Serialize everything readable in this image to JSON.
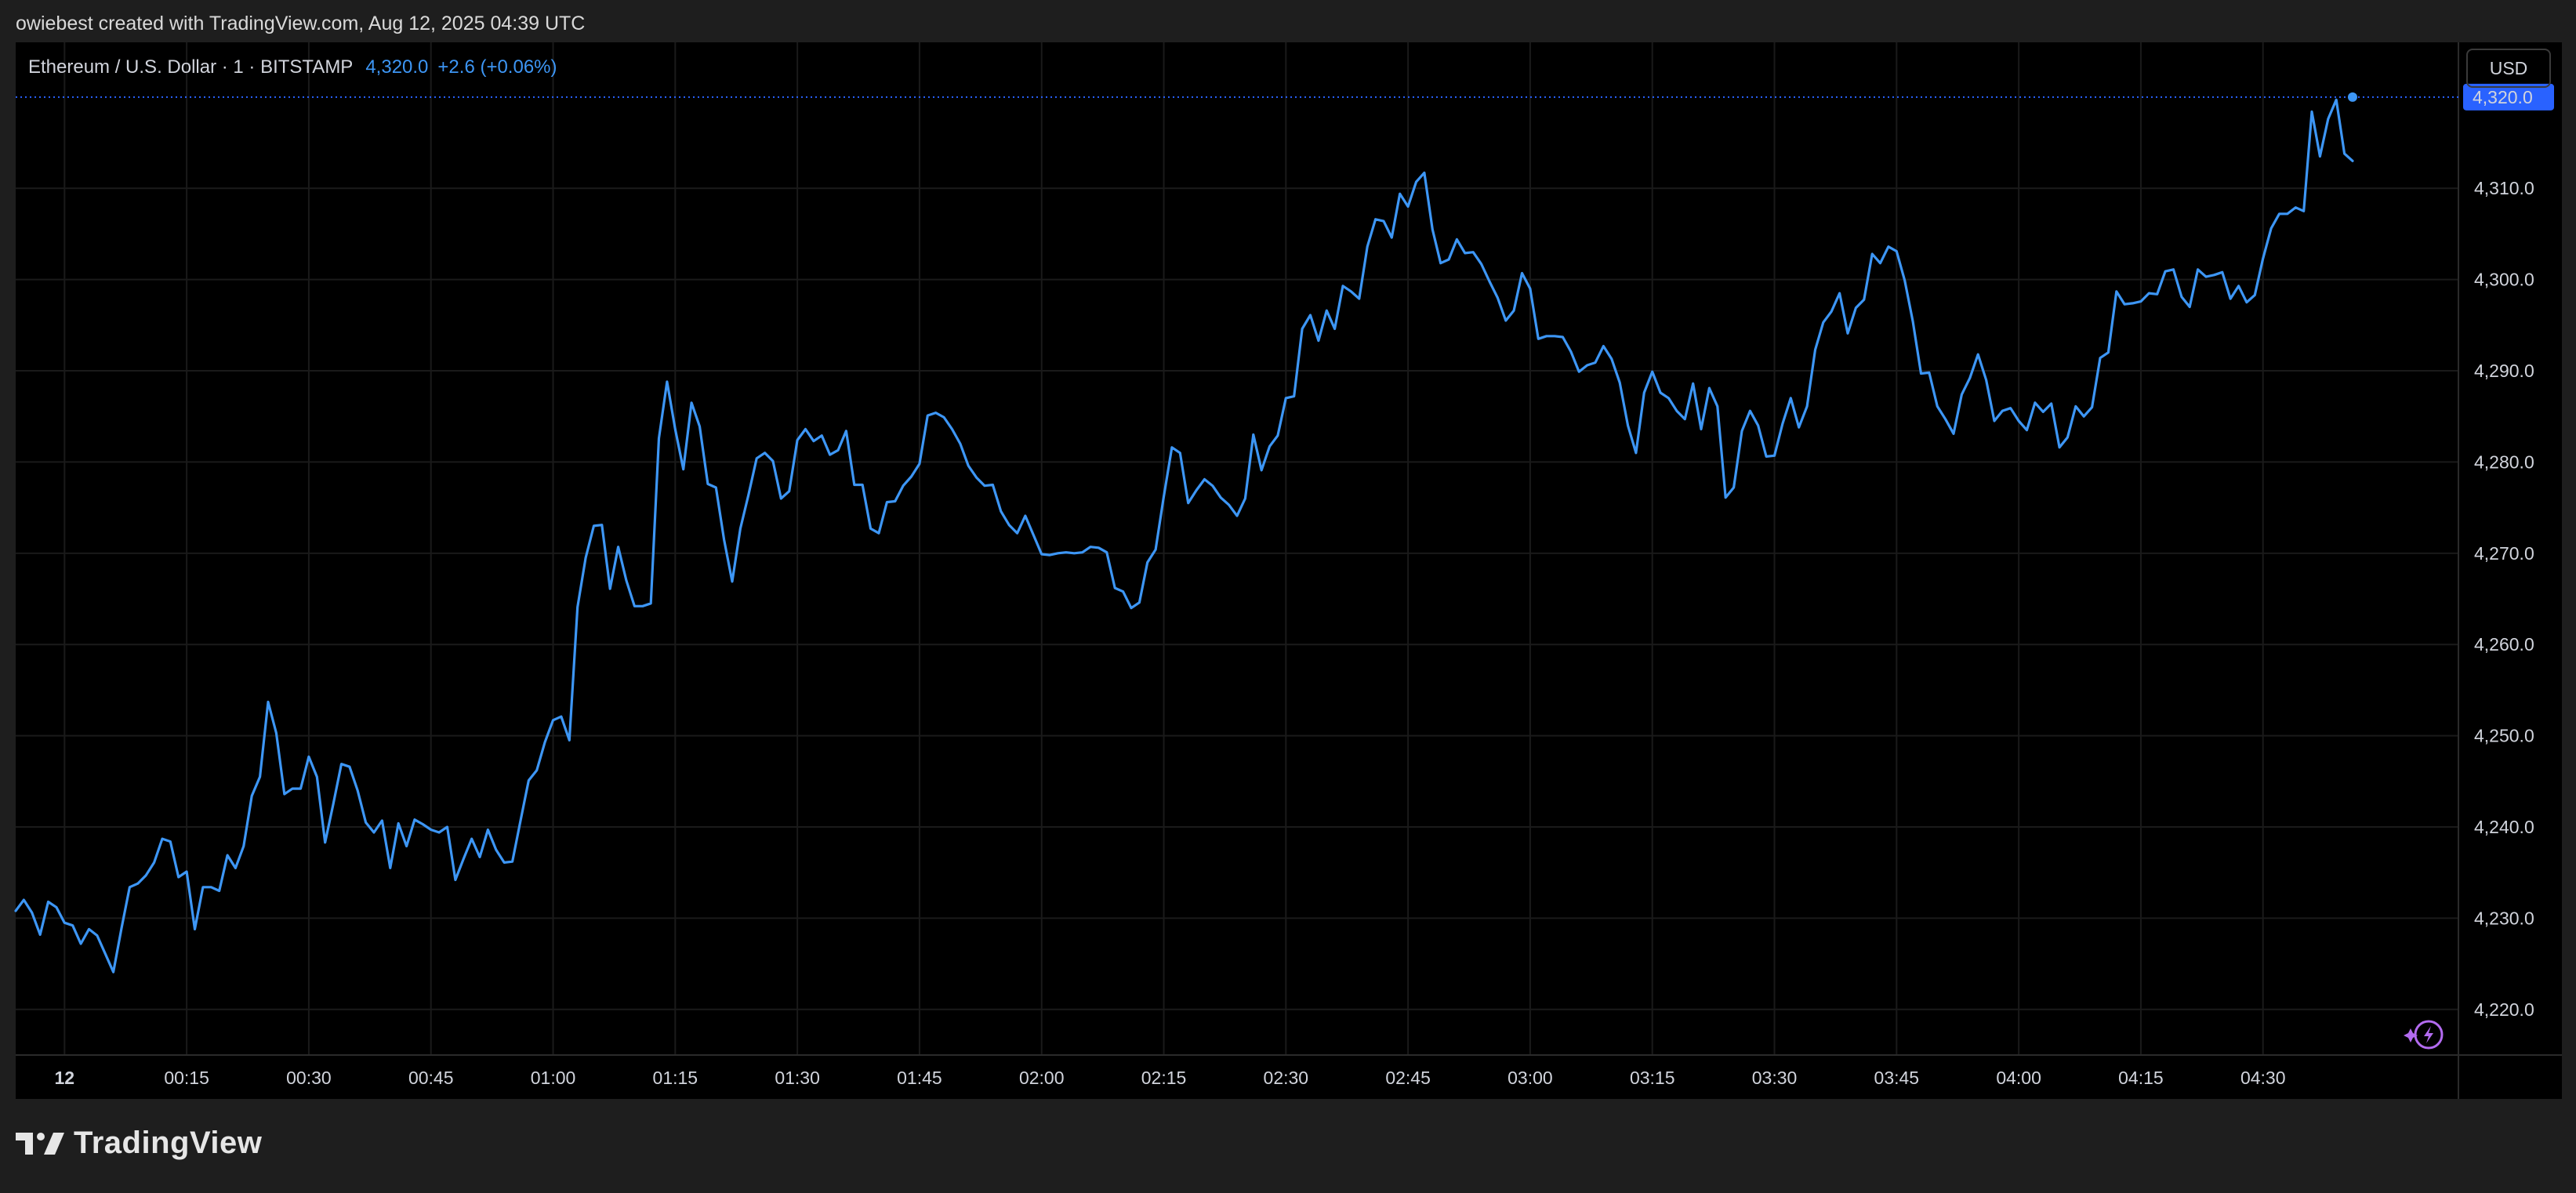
{
  "header": {
    "credit": "owiebest created with TradingView.com, Aug 12, 2025 04:39 UTC"
  },
  "legend": {
    "symbol": "Ethereum / U.S. Dollar · 1 · BITSTAMP",
    "last": "4,320.0",
    "change": "+2.6 (+0.06%)"
  },
  "currency_button": "USD",
  "brand": {
    "name": "TradingView"
  },
  "colors": {
    "line": "#3d96f5",
    "price_label_bg": "#2962ff",
    "grid": "#1a1a1a",
    "background": "#000000",
    "lightning": "#b36bf0"
  },
  "icons": [
    "tradingview-logo-icon",
    "lightning-sparkle-icon"
  ],
  "chart_data": {
    "type": "line",
    "title": "",
    "xlabel": "",
    "ylabel": "",
    "grid": true,
    "ylim": [
      4215,
      4326
    ],
    "xlim": [
      -1.2,
      58.8
    ],
    "y_ticks": [
      4220,
      4230,
      4240,
      4250,
      4260,
      4270,
      4280,
      4290,
      4300,
      4310
    ],
    "y_tick_labels": [
      "4,220.0",
      "4,230.0",
      "4,240.0",
      "4,250.0",
      "4,260.0",
      "4,270.0",
      "4,280.0",
      "4,290.0",
      "4,300.0",
      "4,310.0"
    ],
    "x_ticks": [
      {
        "t": 0,
        "label": "12",
        "bold": true
      },
      {
        "t": 3,
        "label": "00:15"
      },
      {
        "t": 6,
        "label": "00:30"
      },
      {
        "t": 9,
        "label": "00:45"
      },
      {
        "t": 12,
        "label": "01:00"
      },
      {
        "t": 15,
        "label": "01:15"
      },
      {
        "t": 18,
        "label": "01:30"
      },
      {
        "t": 21,
        "label": "01:45"
      },
      {
        "t": 24,
        "label": "02:00"
      },
      {
        "t": 27,
        "label": "02:15"
      },
      {
        "t": 30,
        "label": "02:30"
      },
      {
        "t": 33,
        "label": "02:45"
      },
      {
        "t": 36,
        "label": "03:00"
      },
      {
        "t": 39,
        "label": "03:15"
      },
      {
        "t": 42,
        "label": "03:30"
      },
      {
        "t": 45,
        "label": "03:45"
      },
      {
        "t": 48,
        "label": "04:00"
      },
      {
        "t": 51,
        "label": "04:15"
      },
      {
        "t": 54,
        "label": "04:30"
      }
    ],
    "last_price": 4320.0,
    "last_price_label": "4,320.0",
    "series": [
      {
        "t": [
          -1.2,
          -1.0,
          -0.8,
          -0.6,
          -0.4,
          -0.2,
          0.0,
          0.2,
          0.4,
          0.6,
          0.8,
          1.0,
          1.2,
          1.4,
          1.6,
          1.8,
          2.0,
          2.2,
          2.4,
          2.6,
          2.8,
          3.0,
          3.2,
          3.4,
          3.6,
          3.8,
          4.0,
          4.2,
          4.4,
          4.6,
          4.8,
          5.0,
          5.2,
          5.4,
          5.6,
          5.8,
          6.0,
          6.2,
          6.4,
          6.6,
          6.8,
          7.0,
          7.2,
          7.4,
          7.6,
          7.8,
          8.0,
          8.2,
          8.4,
          8.6,
          8.8,
          9.0,
          9.2,
          9.4,
          9.6,
          9.8,
          10.0,
          10.2,
          10.4,
          10.6,
          10.8,
          11.0,
          11.2,
          11.4,
          11.6,
          11.8,
          12.0,
          12.2,
          12.4,
          12.6,
          12.8,
          13.0,
          13.2,
          13.4,
          13.6,
          13.8,
          14.0,
          14.2,
          14.4,
          14.6,
          14.8,
          15.0,
          15.2,
          15.4,
          15.6,
          15.8,
          16.0,
          16.2,
          16.4,
          16.6,
          16.8,
          17.0,
          17.2,
          17.4,
          17.6,
          17.8,
          18.0,
          18.2,
          18.4,
          18.6,
          18.8,
          19.0,
          19.2,
          19.4,
          19.6,
          19.8,
          20.0,
          20.2,
          20.4,
          20.6,
          20.8,
          21.0,
          21.2,
          21.4,
          21.6,
          21.8,
          22.0,
          22.2,
          22.4,
          22.6,
          22.8,
          23.0,
          23.2,
          23.4,
          23.6,
          23.8,
          24.0,
          24.2,
          24.4,
          24.6,
          24.8,
          25.0,
          25.2,
          25.4,
          25.6,
          25.8,
          26.0,
          26.2,
          26.4,
          26.6,
          26.8,
          27.0,
          27.2,
          27.4,
          27.6,
          27.8,
          28.0,
          28.2,
          28.4,
          28.6,
          28.8,
          29.0,
          29.2,
          29.4,
          29.6,
          29.8,
          30.0,
          30.2,
          30.4,
          30.6,
          30.8,
          31.0,
          31.2,
          31.4,
          31.6,
          31.8,
          32.0,
          32.2,
          32.4,
          32.6,
          32.8,
          33.0,
          33.2,
          33.4,
          33.6,
          33.8,
          34.0,
          34.2,
          34.4,
          34.6,
          34.8,
          35.0,
          35.2,
          35.4,
          35.6,
          35.8,
          36.0,
          36.2,
          36.4,
          36.6,
          36.8,
          37.0,
          37.2,
          37.4,
          37.6,
          37.8,
          38.0,
          38.2,
          38.4,
          38.6,
          38.8,
          39.0,
          39.2,
          39.4,
          39.6,
          39.8,
          40.0,
          40.2,
          40.4,
          40.6,
          40.8,
          41.0,
          41.2,
          41.4,
          41.6,
          41.8,
          42.0,
          42.2,
          42.4,
          42.6,
          42.8,
          43.0,
          43.2,
          43.4,
          43.6,
          43.8,
          44.0,
          44.2,
          44.4,
          44.6,
          44.8,
          45.0,
          45.2,
          45.4,
          45.6,
          45.8,
          46.0,
          46.2,
          46.4,
          46.6,
          46.8,
          47.0,
          47.2,
          47.4,
          47.6,
          47.8,
          48.0,
          48.2,
          48.4,
          48.6,
          48.8,
          49.0,
          49.2,
          49.4,
          49.6,
          49.8,
          50.0,
          50.2,
          50.4,
          50.6,
          50.8,
          51.0,
          51.2,
          51.4,
          51.6,
          51.8,
          52.0,
          52.2,
          52.4,
          52.6,
          52.8,
          53.0,
          53.2,
          53.4,
          53.6,
          53.8,
          54.0,
          54.2,
          54.4,
          54.6,
          54.8,
          55.0,
          55.2,
          55.4,
          55.6,
          55.8,
          56.0,
          56.2
        ],
        "values": [
          4230.8,
          4232.0,
          4230.6,
          4228.2,
          4231.8,
          4231.2,
          4229.5,
          4229.2,
          4227.2,
          4228.8,
          4228.1,
          4226.1,
          4224.1,
          4228.9,
          4233.4,
          4233.8,
          4234.7,
          4236.1,
          4238.7,
          4238.4,
          4234.5,
          4235.1,
          4228.8,
          4233.4,
          4233.4,
          4233.0,
          4236.9,
          4235.5,
          4237.9,
          4243.4,
          4245.5,
          4253.7,
          4250.3,
          4243.6,
          4244.2,
          4244.2,
          4247.7,
          4245.5,
          4238.3,
          4242.5,
          4246.9,
          4246.6,
          4244.0,
          4240.5,
          4239.4,
          4240.7,
          4235.5,
          4240.4,
          4237.9,
          4240.8,
          4240.3,
          4239.7,
          4239.4,
          4240.0,
          4234.2,
          4236.5,
          4238.7,
          4236.7,
          4239.7,
          4237.5,
          4236.1,
          4236.2,
          4240.7,
          4245.1,
          4246.2,
          4249.3,
          4251.7,
          4252.1,
          4249.5,
          4264.1,
          4269.5,
          4273.0,
          4273.1,
          4266.1,
          4270.7,
          4267.0,
          4264.2,
          4264.2,
          4264.5,
          4282.6,
          4288.8,
          4283.6,
          4279.2,
          4286.5,
          4283.9,
          4277.6,
          4277.2,
          4271.5,
          4266.9,
          4272.7,
          4276.4,
          4280.4,
          4281.0,
          4280.1,
          4276.0,
          4276.8,
          4282.4,
          4283.6,
          4282.3,
          4282.9,
          4280.8,
          4281.3,
          4283.4,
          4277.5,
          4277.5,
          4272.7,
          4272.2,
          4275.6,
          4275.7,
          4277.4,
          4278.4,
          4279.8,
          4285.1,
          4285.4,
          4284.9,
          4283.6,
          4282.0,
          4279.6,
          4278.3,
          4277.4,
          4277.5,
          4274.6,
          4273.1,
          4272.2,
          4274.1,
          4272.0,
          4269.9,
          4269.8,
          4270.0,
          4270.1,
          4270.0,
          4270.1,
          4270.7,
          4270.6,
          4270.1,
          4266.2,
          4265.8,
          4264.0,
          4264.6,
          4269.0,
          4270.4,
          4276.2,
          4281.6,
          4281.0,
          4275.5,
          4276.9,
          4278.1,
          4277.4,
          4276.1,
          4275.3,
          4274.1,
          4276.0,
          4283.0,
          4279.1,
          4281.7,
          4282.9,
          4287.0,
          4287.2,
          4294.6,
          4296.1,
          4293.3,
          4296.6,
          4294.6,
          4299.3,
          4298.7,
          4297.9,
          4303.6,
          4306.6,
          4306.4,
          4304.6,
          4309.4,
          4308.0,
          4310.7,
          4311.7,
          4305.5,
          4301.8,
          4302.2,
          4304.4,
          4302.9,
          4303.0,
          4301.7,
          4299.8,
          4298.0,
          4295.5,
          4296.6,
          4300.7,
          4299.0,
          4293.5,
          4293.8,
          4293.8,
          4293.7,
          4292.1,
          4289.9,
          4290.6,
          4290.9,
          4292.7,
          4291.3,
          4288.7,
          4284.0,
          4281.0,
          4287.6,
          4289.9,
          4287.6,
          4287.0,
          4285.6,
          4284.7,
          4288.6,
          4283.6,
          4288.1,
          4286.1,
          4276.1,
          4277.2,
          4283.4,
          4285.6,
          4284.0,
          4280.6,
          4280.7,
          4284.2,
          4287.0,
          4283.8,
          4286.1,
          4292.3,
          4295.3,
          4296.5,
          4298.5,
          4294.1,
          4296.9,
          4297.8,
          4302.8,
          4301.8,
          4303.6,
          4303.1,
          4299.9,
          4295.4,
          4289.7,
          4289.8,
          4286.1,
          4284.7,
          4283.1,
          4287.4,
          4289.2,
          4291.8,
          4289.0,
          4284.5,
          4285.6,
          4285.9,
          4284.5,
          4283.5,
          4286.5,
          4285.5,
          4286.4,
          4281.6,
          4282.7,
          4286.1,
          4285.0,
          4286.0,
          4291.4,
          4292.0,
          4298.7,
          4297.3,
          4297.4,
          4297.6,
          4298.5,
          4298.4,
          4300.9,
          4301.1,
          4298.1,
          4297.0,
          4301.1,
          4300.3,
          4300.5,
          4300.8,
          4297.9,
          4299.3,
          4297.5,
          4298.3,
          4302.3,
          4305.6,
          4307.2,
          4307.2,
          4307.9,
          4307.5,
          4318.4,
          4313.5,
          4317.6,
          4319.7,
          4313.8,
          4313.0,
          4317.6,
          4320.0
        ]
      }
    ]
  }
}
